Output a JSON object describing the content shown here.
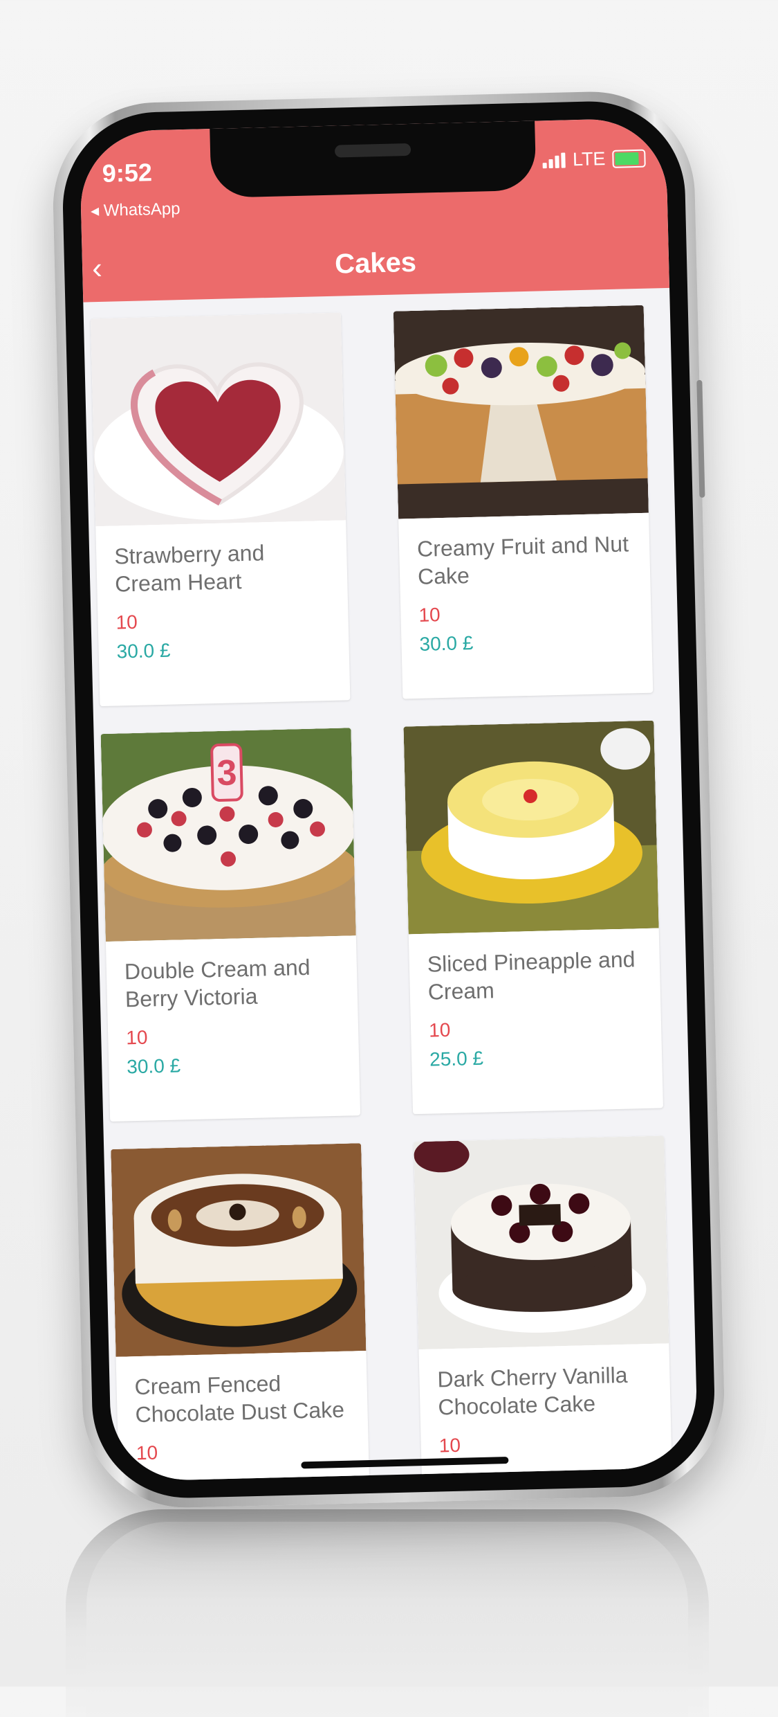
{
  "status_bar": {
    "time": "9:52",
    "back_app": "WhatsApp",
    "network": "LTE"
  },
  "header": {
    "title": "Cakes",
    "background": "#ec6b6b"
  },
  "products": [
    {
      "name": "Strawberry and Cream Heart",
      "count": "10",
      "price": "30.0 £",
      "image": "strawberry-heart-cake-image"
    },
    {
      "name": "Creamy Fruit and Nut Cake",
      "count": "10",
      "price": "30.0 £",
      "image": "fruit-nut-cake-image"
    },
    {
      "name": "Double Cream and Berry Victoria",
      "count": "10",
      "price": "30.0 £",
      "image": "berry-victoria-cake-image"
    },
    {
      "name": "Sliced Pineapple and Cream",
      "count": "10",
      "price": "25.0 £",
      "image": "pineapple-cream-cake-image"
    },
    {
      "name": "Cream Fenced Chocolate Dust Cake",
      "count": "10",
      "price": "",
      "image": "chocolate-dust-cake-image"
    },
    {
      "name": "Dark Cherry Vanilla Chocolate Cake",
      "count": "10",
      "price": "",
      "image": "cherry-chocolate-cake-image"
    }
  ],
  "colors": {
    "count_red": "#e4484e",
    "price_teal": "#2aa9a4",
    "name_grey": "#6e6e6e"
  }
}
